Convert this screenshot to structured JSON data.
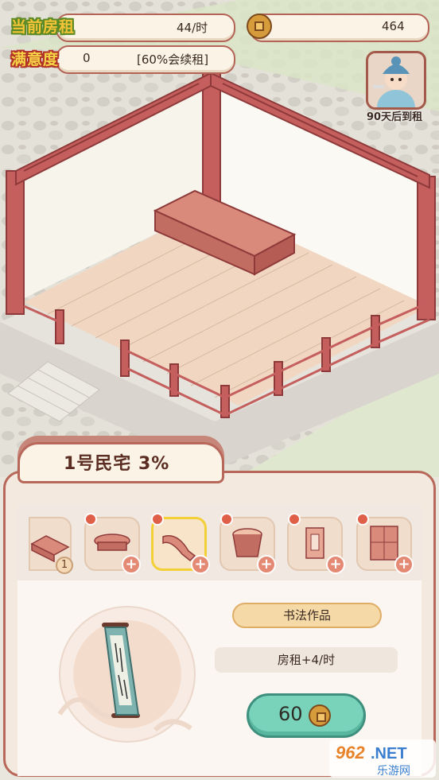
{
  "hud": {
    "rent_label": "当前房租",
    "rent_value": "44/时",
    "satisfaction_label": "满意度",
    "satisfaction_value": "0",
    "satisfaction_note": "[60%会续租]",
    "coins": "464"
  },
  "tenant": {
    "countdown": "90天后到租"
  },
  "house": {
    "title": "1号民宅 3%"
  },
  "furniture_slots": [
    {
      "icon": "bed-icon",
      "count": "1"
    },
    {
      "icon": "table-icon"
    },
    {
      "icon": "scroll-icon"
    },
    {
      "icon": "washbasin-icon"
    },
    {
      "icon": "lantern-icon"
    },
    {
      "icon": "cabinet-icon"
    }
  ],
  "detail": {
    "item_name": "书法作品",
    "effect": "房租+4/时",
    "price": "60"
  },
  "watermark": {
    "logo": "962.NET",
    "subtitle": "乐游网"
  },
  "colors": {
    "accent_red": "#b8685a",
    "buy_button": "#79d3bb",
    "selected_border": "#f3cf38",
    "badge_red": "#e05f48"
  }
}
